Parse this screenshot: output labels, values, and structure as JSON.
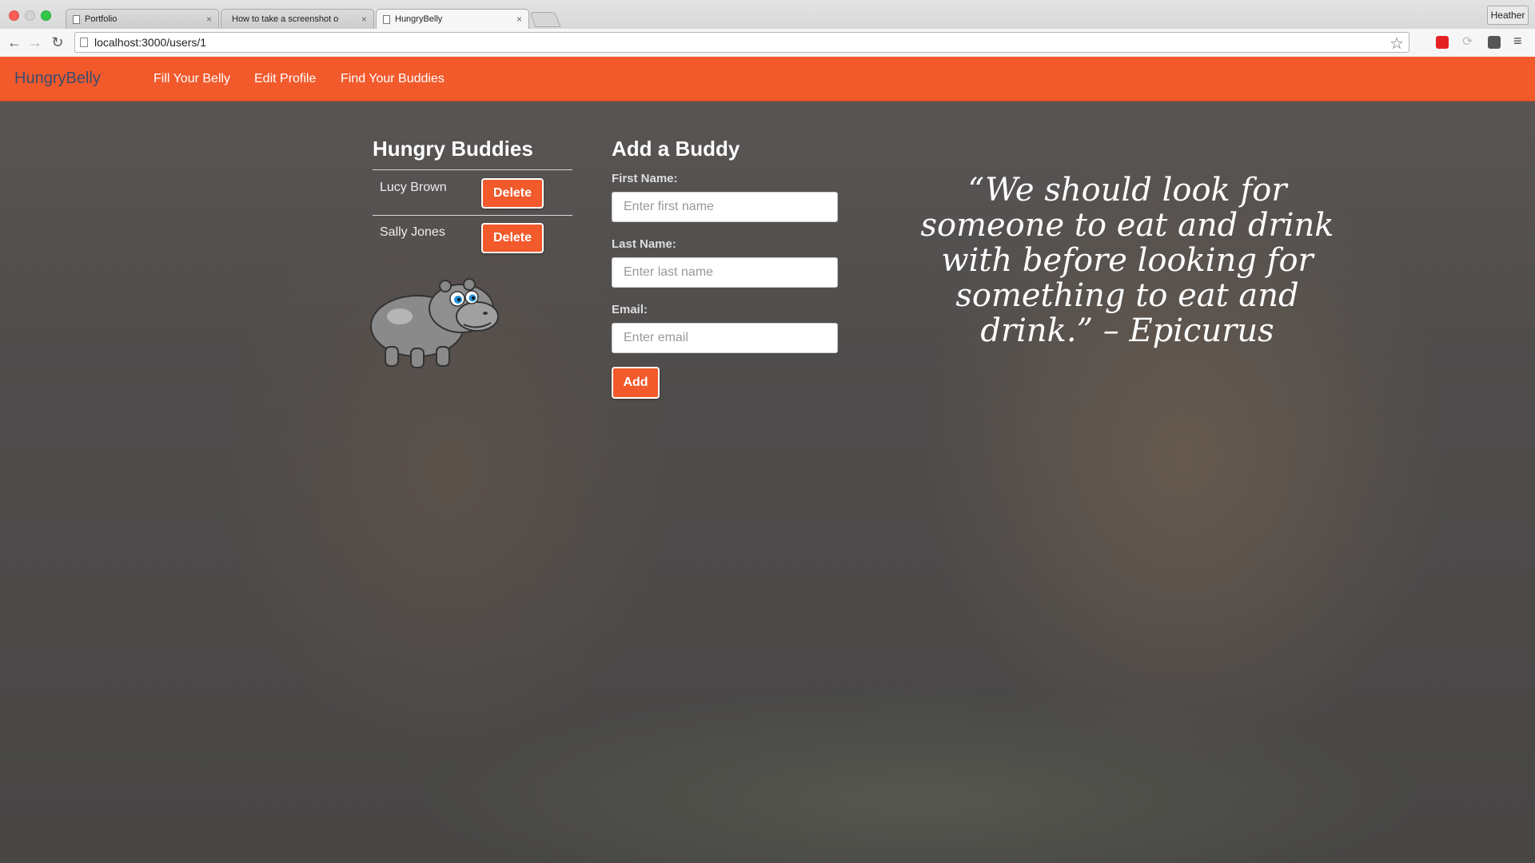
{
  "browser": {
    "tabs": [
      {
        "title": "Portfolio"
      },
      {
        "title": "How to take a screenshot o"
      },
      {
        "title": "HungryBelly"
      }
    ],
    "url": "localhost:3000/users/1",
    "user": "Heather"
  },
  "navbar": {
    "brand": "HungryBelly",
    "links": [
      "Fill Your Belly",
      "Edit Profile",
      "Find Your Buddies"
    ]
  },
  "buddies": {
    "title": "Hungry Buddies",
    "items": [
      {
        "name": "Lucy Brown",
        "action": "Delete"
      },
      {
        "name": "Sally Jones",
        "action": "Delete"
      }
    ]
  },
  "add_buddy": {
    "title": "Add a Buddy",
    "first_name": {
      "label": "First Name:",
      "placeholder": "Enter first name"
    },
    "last_name": {
      "label": "Last Name:",
      "placeholder": "Enter last name"
    },
    "email": {
      "label": "Email:",
      "placeholder": "Enter email"
    },
    "submit": "Add"
  },
  "quote": "“We should look for someone to eat and drink with before looking for something to eat and drink.” – Epicurus",
  "colors": {
    "accent": "#f2592b",
    "brand_text": "#3a4e70"
  }
}
